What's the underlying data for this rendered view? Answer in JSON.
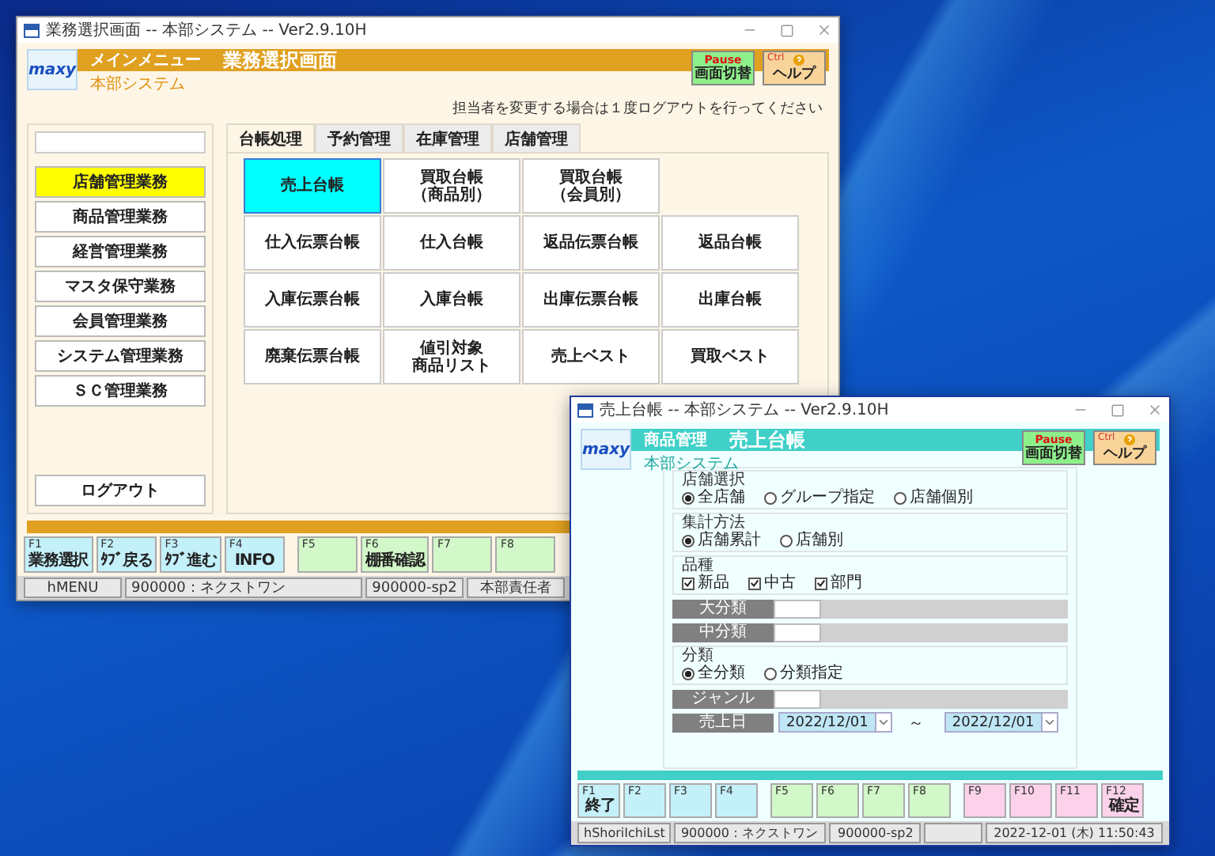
{
  "main_window": {
    "title": "業務選択画面 -- 本部システム -- Ver2.9.10H",
    "logo": "maxy",
    "menu_label": "メインメニュー",
    "screen_title": "業務選択画面",
    "system_name": "本部システム",
    "header_buttons": [
      {
        "kind": "pause",
        "key": "Pause",
        "label": "画面切替"
      },
      {
        "kind": "help",
        "key": "Ctrl",
        "label": "ヘルプ"
      }
    ],
    "notice": "担当者を変更する場合は１度ログアウトを行ってください",
    "sidebar": {
      "items": [
        {
          "label": "店舗管理業務",
          "selected": true
        },
        {
          "label": "商品管理業務",
          "selected": false
        },
        {
          "label": "経営管理業務",
          "selected": false
        },
        {
          "label": "マスタ保守業務",
          "selected": false
        },
        {
          "label": "会員管理業務",
          "selected": false
        },
        {
          "label": "システム管理業務",
          "selected": false
        },
        {
          "label": "ＳＣ管理業務",
          "selected": false
        }
      ],
      "logout": "ログアウト"
    },
    "tabs": [
      {
        "label": "台帳処理",
        "selected": true
      },
      {
        "label": "予約管理",
        "selected": false
      },
      {
        "label": "在庫管理",
        "selected": false
      },
      {
        "label": "店舗管理",
        "selected": false
      }
    ],
    "tile_rows": [
      [
        {
          "label": "売上台帳",
          "selected": true
        },
        {
          "lines": [
            "買取台帳",
            "（商品別）"
          ],
          "selected": false
        },
        {
          "lines": [
            "買取台帳",
            "（会員別）"
          ],
          "selected": false
        }
      ],
      [
        {
          "label": "仕入伝票台帳",
          "selected": false
        },
        {
          "label": "仕入台帳",
          "selected": false
        },
        {
          "label": "返品伝票台帳",
          "selected": false
        },
        {
          "label": "返品台帳",
          "selected": false
        }
      ],
      [
        {
          "label": "入庫伝票台帳",
          "selected": false
        },
        {
          "label": "入庫台帳",
          "selected": false
        },
        {
          "label": "出庫伝票台帳",
          "selected": false
        },
        {
          "label": "出庫台帳",
          "selected": false
        }
      ],
      [
        {
          "label": "廃棄伝票台帳",
          "selected": false
        },
        {
          "lines": [
            "値引対象",
            "商品リスト"
          ],
          "selected": false
        },
        {
          "label": "売上ベスト",
          "selected": false
        },
        {
          "label": "買取ベスト",
          "selected": false
        }
      ]
    ],
    "function_keys": [
      {
        "key": "F1",
        "label": "業務選択",
        "color": "#c4f0fa"
      },
      {
        "key": "F2",
        "label": "ﾀﾌﾞ戻る",
        "color": "#c4f0fa"
      },
      {
        "key": "F3",
        "label": "ﾀﾌﾞ進む",
        "color": "#c4f0fa"
      },
      {
        "key": "F4",
        "label": "INFO",
        "color": "#c4f0fa"
      },
      {
        "key": "F5",
        "color": "#d2f7c8"
      },
      {
        "key": "F6",
        "label": "棚番確認",
        "color": "#d2f7c8"
      },
      {
        "key": "F7",
        "color": "#d2f7c8"
      },
      {
        "key": "F8",
        "color": "#d2f7c8"
      }
    ],
    "status_bar": [
      "hMENU",
      "900000：ネクストワン",
      "900000-sp2",
      "本部責任者"
    ]
  },
  "report_window": {
    "title": "売上台帳 -- 本部システム -- Ver2.9.10H",
    "logo": "maxy",
    "category": "商品管理",
    "screen_title": "売上台帳",
    "system_name": "本部システム",
    "header_buttons": [
      {
        "kind": "pause",
        "key": "Pause",
        "label": "画面切替"
      },
      {
        "kind": "help",
        "key": "Ctrl",
        "label": "ヘルプ"
      }
    ],
    "form": [
      {
        "kind": "radio",
        "label": "店舗選択",
        "options": [
          {
            "label": "全店舗",
            "selected": true
          },
          {
            "label": "グループ指定",
            "selected": false
          },
          {
            "label": "店舗個別",
            "selected": false
          }
        ]
      },
      {
        "kind": "radio",
        "label": "集計方法",
        "options": [
          {
            "label": "店舗累計",
            "selected": true
          },
          {
            "label": "店舗別",
            "selected": false
          }
        ]
      },
      {
        "kind": "checkbox",
        "label": "品種",
        "options": [
          {
            "label": "新品",
            "checked": true
          },
          {
            "label": "中古",
            "checked": true
          },
          {
            "label": "部門",
            "checked": true
          }
        ]
      },
      {
        "kind": "code",
        "label": "大分類"
      },
      {
        "kind": "code",
        "label": "中分類"
      },
      {
        "kind": "radio",
        "label": "分類",
        "options": [
          {
            "label": "全分類",
            "selected": true
          },
          {
            "label": "分類指定",
            "selected": false
          }
        ]
      },
      {
        "kind": "code",
        "label": "ジャンル"
      },
      {
        "kind": "date_range",
        "label": "売上日",
        "from": "2022/12/01",
        "separator": "～",
        "to": "2022/12/01"
      }
    ],
    "function_keys": [
      {
        "key": "F1",
        "label": "終了",
        "color": "#c4f0fa"
      },
      {
        "key": "F2",
        "color": "#c4f0fa"
      },
      {
        "key": "F3",
        "color": "#c4f0fa"
      },
      {
        "key": "F4",
        "color": "#c4f0fa"
      },
      {
        "key": "F5",
        "color": "#d2f7c8"
      },
      {
        "key": "F6",
        "color": "#d2f7c8"
      },
      {
        "key": "F7",
        "color": "#d2f7c8"
      },
      {
        "key": "F8",
        "color": "#d2f7c8"
      },
      {
        "key": "F9",
        "color": "#fcd2ea"
      },
      {
        "key": "F10",
        "color": "#fcd2ea"
      },
      {
        "key": "F11",
        "color": "#fcd2ea"
      },
      {
        "key": "F12",
        "label": "確定",
        "color": "#fcd2ea"
      }
    ],
    "status_bar": {
      "cells": [
        "hShoriIchiLst",
        "900000：ネクストワン",
        "900000-sp2"
      ],
      "clock": "2022-12-01 (木) 11:50:43"
    }
  }
}
